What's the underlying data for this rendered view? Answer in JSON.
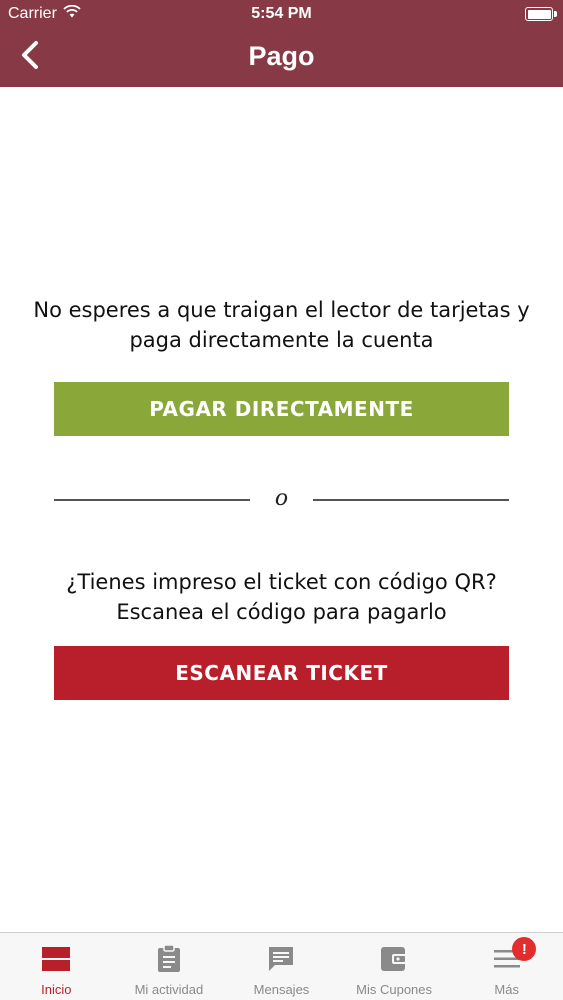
{
  "status_bar": {
    "carrier": "Carrier",
    "time": "5:54 PM"
  },
  "nav": {
    "title": "Pago"
  },
  "direct_pay": {
    "description": "No esperes a que traigan el lector de tarjetas y paga directamente la cuenta",
    "button_label": "PAGAR DIRECTAMENTE"
  },
  "divider": {
    "text": "o"
  },
  "scan": {
    "description": "¿Tienes impreso el ticket con código QR? Escanea el código para pagarlo",
    "button_label": "ESCANEAR TICKET"
  },
  "tabs": [
    {
      "label": "Inicio",
      "icon": "home-icon",
      "active": true
    },
    {
      "label": "Mi actividad",
      "icon": "clipboard-icon"
    },
    {
      "label": "Mensajes",
      "icon": "message-icon"
    },
    {
      "label": "Mis Cupones",
      "icon": "wallet-icon"
    },
    {
      "label": "Más",
      "icon": "menu-icon",
      "badge": "!"
    }
  ],
  "colors": {
    "header": "#873a45",
    "green_button": "#8aa83a",
    "red_button": "#b91f2a",
    "badge": "#e12d2d"
  }
}
